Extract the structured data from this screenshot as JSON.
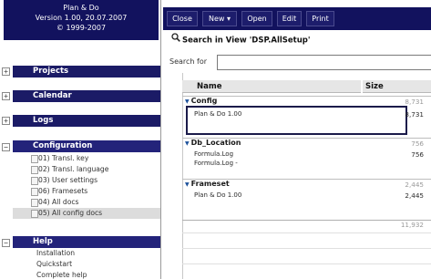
{
  "brand": {
    "line1": "Plan & Do",
    "line2": "Version 1.00, 20.07.2007",
    "line3": "© 1999-2007"
  },
  "sections": [
    {
      "label": "Projects",
      "toggle": "+"
    },
    {
      "label": "Calendar",
      "toggle": "+"
    },
    {
      "label": "Logs",
      "toggle": "+"
    },
    {
      "label": "Configuration",
      "toggle": "−"
    },
    {
      "label": "Help",
      "toggle": "−"
    }
  ],
  "config_items": [
    "01) Transl. key",
    "02) Transl. language",
    "03) User settings",
    "06) Framesets",
    "04) All docs",
    "05) All config docs"
  ],
  "help_items": [
    "Installation",
    "Quickstart",
    "Complete help"
  ],
  "toolbar": {
    "close": "Close",
    "new": "New ▾",
    "open": "Open",
    "edit": "Edit",
    "print": "Print"
  },
  "view_title": "Search in View 'DSP.AllSetup'",
  "search": {
    "label": "Search for",
    "value": ""
  },
  "columns": {
    "name": "Name",
    "size": "Size"
  },
  "groups": [
    {
      "name": "Config",
      "total": "8,731",
      "rows": [
        {
          "name": "Plan & Do 1.00",
          "size": "8,731"
        }
      ]
    },
    {
      "name": "Db_Location",
      "total": "756",
      "rows": [
        {
          "name": "Formula.Log",
          "size": "756"
        },
        {
          "name": "Formula.Log -",
          "size": ""
        }
      ]
    },
    {
      "name": "Frameset",
      "total": "2,445",
      "rows": [
        {
          "name": "Plan & Do 1.00",
          "size": "2,445"
        }
      ]
    }
  ],
  "grand_total": "11,932",
  "colors": {
    "navy": "#12125e",
    "selected_row": "#dcdcdc"
  },
  "icons": {
    "search": "magnifier-icon",
    "expand": "triangle-down-icon"
  }
}
